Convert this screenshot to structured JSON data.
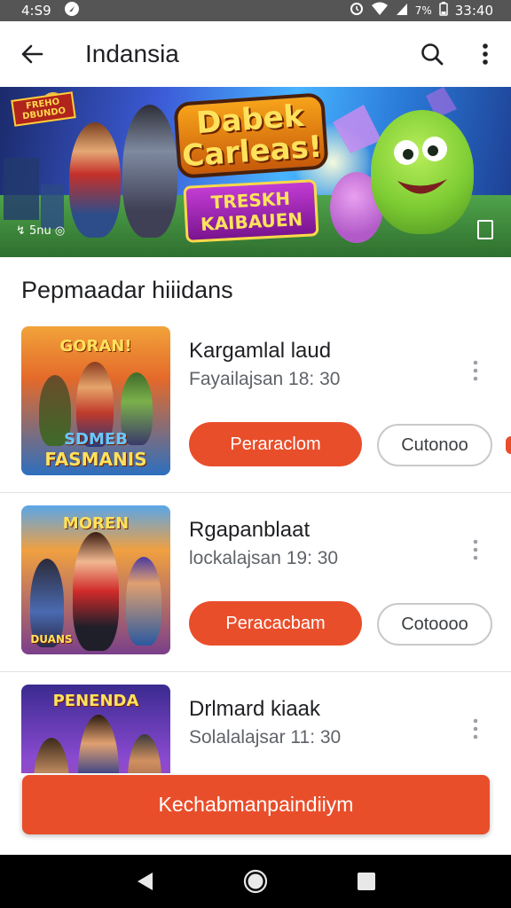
{
  "status_bar": {
    "time": "4:S9",
    "right_time": "33:40",
    "battery": "7%"
  },
  "app_bar": {
    "title": "Indansia",
    "icons": [
      "back-arrow-icon",
      "search-icon",
      "more-vert-icon"
    ]
  },
  "banner": {
    "logo_line1": "Dabek",
    "logo_line2": "Carleas!",
    "ribbon_line1": "TRESKH",
    "ribbon_line2": "KAIBAUEN",
    "badge": "FREHO DBUNDO",
    "corner_text": "↯ 5nu ◎"
  },
  "section": {
    "title": "Pepmaadar hiiidans"
  },
  "games": [
    {
      "name": "Kargamlal laud",
      "meta": "Fayailajsan 18: 30",
      "primary_label": "Peraraclom",
      "secondary_label": "Cutonoo",
      "thumb_top": "GORAN!",
      "thumb_bottom_1": "SDMEB",
      "thumb_bottom_2": "FASMANIS",
      "colors": {
        "bg_top": "#f2a33a",
        "bg_bottom": "#2d6fbf"
      }
    },
    {
      "name": "Rgapanblaat",
      "meta": "lockalajsan 19: 30",
      "primary_label": "Peracacbam",
      "secondary_label": "Cotoooo",
      "thumb_top": "MOREN",
      "thumb_bottom_1": "DUANS",
      "thumb_bottom_2": "",
      "colors": {
        "bg_top": "#5aa6e8",
        "bg_bottom": "#7a3f8a"
      }
    },
    {
      "name": "Drlmard kiaak",
      "meta": "Solalalajsar 11: 30",
      "primary_label": "",
      "secondary_label": "",
      "thumb_top": "PENENDA",
      "thumb_bottom_1": "",
      "thumb_bottom_2": "",
      "colors": {
        "bg_top": "#3a2a8f",
        "bg_bottom": "#b04aa8"
      }
    }
  ],
  "cta": {
    "label": "Kechabmanpaindiiym"
  },
  "nav_bar": {
    "icons": [
      "back-triangle-icon",
      "home-circle-icon",
      "recents-square-icon"
    ]
  },
  "theme": {
    "accent": "#e94e2b",
    "status_bar_bg": "#555555"
  }
}
